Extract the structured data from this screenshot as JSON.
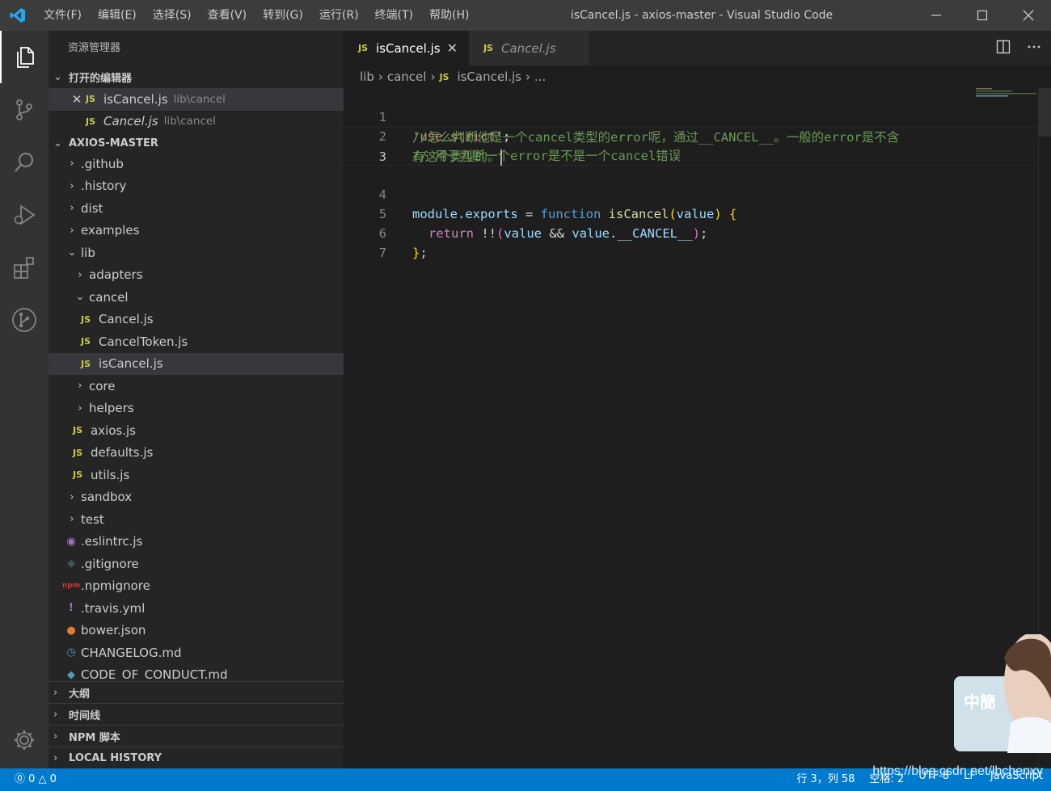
{
  "title_bar": {
    "menu": [
      "文件(F)",
      "编辑(E)",
      "选择(S)",
      "查看(V)",
      "转到(G)",
      "运行(R)",
      "终端(T)",
      "帮助(H)"
    ],
    "window_title": "isCancel.js - axios-master - Visual Studio Code"
  },
  "sidebar": {
    "title": "资源管理器",
    "open_editors": {
      "header": "打开的编辑器",
      "items": [
        {
          "name": "isCancel.js",
          "path": "lib\\cancel"
        },
        {
          "name": "Cancel.js",
          "path": "lib\\cancel"
        }
      ]
    },
    "project": {
      "header": "AXIOS-MASTER",
      "items": [
        {
          "label": ".github"
        },
        {
          "label": ".history"
        },
        {
          "label": "dist"
        },
        {
          "label": "examples"
        },
        {
          "label": "lib"
        },
        {
          "label": "adapters"
        },
        {
          "label": "cancel"
        },
        {
          "label": "Cancel.js"
        },
        {
          "label": "CancelToken.js"
        },
        {
          "label": "isCancel.js"
        },
        {
          "label": "core"
        },
        {
          "label": "helpers"
        },
        {
          "label": "axios.js"
        },
        {
          "label": "defaults.js"
        },
        {
          "label": "utils.js"
        },
        {
          "label": "sandbox"
        },
        {
          "label": "test"
        },
        {
          "label": ".eslintrc.js"
        },
        {
          "label": ".gitignore"
        },
        {
          "label": ".npmignore"
        },
        {
          "label": ".travis.yml"
        },
        {
          "label": "bower.json"
        },
        {
          "label": "CHANGELOG.md"
        },
        {
          "label": "CODE_OF_CONDUCT.md"
        }
      ]
    },
    "bottom_sections": [
      "大纲",
      "时间线",
      "NPM 脚本",
      "LOCAL HISTORY"
    ]
  },
  "editor": {
    "tabs": [
      {
        "label": "isCancel.js",
        "icon": "JS"
      },
      {
        "label": "Cancel.js",
        "icon": "JS"
      }
    ],
    "breadcrumb": [
      "lib",
      "cancel",
      "isCancel.js",
      "..."
    ],
    "line_numbers": [
      "1",
      "2",
      "3",
      "4",
      "5",
      "6",
      "7"
    ],
    "code": {
      "l1_str": "'use strict'",
      "l1_semi": ";",
      "l2_comment": "// 用于判断一个error是不是一个cancel错误",
      "l3_comment_a": "//怎么判断他是一个cancel类型的error呢，通过__CANCEL__。一般的error是不含",
      "l3_comment_b": "有这个类型的。",
      "l4_module": "module",
      "l4_dot": ".",
      "l4_exports": "exports",
      "l4_eq": " = ",
      "l4_function": "function",
      "l4_name": "isCancel",
      "l4_paren_open": "(",
      "l4_param": "value",
      "l4_paren_close": ")",
      "l4_brace": "{",
      "l5_return": "return",
      "l5_not": " !!",
      "l5_paren_open": "(",
      "l5_value": "value",
      "l5_and": " && ",
      "l5_value2": "value",
      "l5_dot": ".",
      "l5_prop": "__CANCEL__",
      "l5_paren_close": ")",
      "l5_semi": ";",
      "l6_brace": "}",
      "l6_semi": ";"
    }
  },
  "status_bar": {
    "left": "⓪ 0  △ 0",
    "right": [
      "行 3，列 58",
      "空格: 2",
      "UTF-8",
      "LF",
      "JavaScript"
    ]
  },
  "watermark": "https://blog.csdn.net/lbchenxy",
  "ime_widget": {
    "text": "中簡"
  },
  "colors": {
    "accent": "#007acc",
    "titlebar": "#3c3c3c",
    "sidebar": "#252526",
    "activitybar": "#333333",
    "editor_bg": "#1e1e1e"
  }
}
